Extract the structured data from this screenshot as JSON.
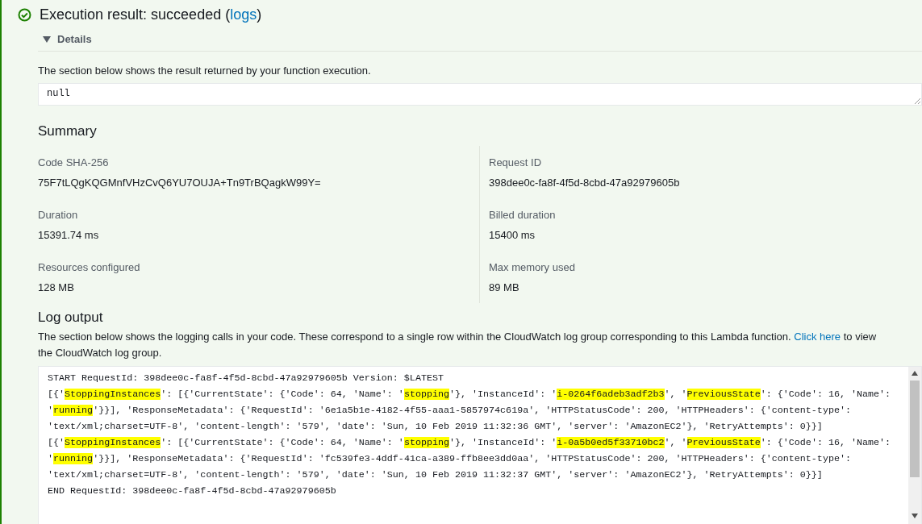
{
  "result": {
    "title_before": "Execution result:",
    "status": "succeeded",
    "title_mid": "(",
    "link": "logs",
    "title_after": ")"
  },
  "details": {
    "label": "Details",
    "expanded": true
  },
  "result_note": "The section below shows the result returned by your function execution.",
  "result_value": "null",
  "summary": {
    "title": "Summary",
    "fields": [
      {
        "label": "Code SHA-256",
        "value": "75F7tLQgKQGMnfVHzCvQ6YU7OUJA+Tn9TrBQagkW99Y="
      },
      {
        "label": "Request ID",
        "value": "398dee0c-fa8f-4f5d-8cbd-47a92979605b"
      },
      {
        "label": "Duration",
        "value": "15391.74 ms"
      },
      {
        "label": "Billed duration",
        "value": "15400 ms"
      },
      {
        "label": "Resources configured",
        "value": "128 MB"
      },
      {
        "label": "Max memory used",
        "value": "89 MB"
      }
    ]
  },
  "log_output": {
    "title": "Log output",
    "note_before": "The section below shows the logging calls in your code. These correspond to a single row within the CloudWatch log group corresponding to this Lambda function.",
    "note_link": "Click here",
    "note_after": "to view the CloudWatch log group.",
    "entries": [
      [
        {
          "text": "START RequestId: 398dee0c-fa8f-4f5d-8cbd-47a92979605b Version: $LATEST",
          "highlighted": false
        }
      ],
      [
        {
          "text": "[{'",
          "highlighted": false
        },
        {
          "text": "StoppingInstances",
          "highlighted": true
        },
        {
          "text": "': [{'CurrentState': {'Code': 64, 'Name': '",
          "highlighted": false
        },
        {
          "text": "stopping",
          "highlighted": true
        },
        {
          "text": "'}, 'InstanceId': '",
          "highlighted": false
        },
        {
          "text": "i-0264f6adeb3adf2b3",
          "highlighted": true
        },
        {
          "text": "', '",
          "highlighted": false
        },
        {
          "text": "PreviousState",
          "highlighted": true
        },
        {
          "text": "': {'Code': 16, 'Name': '",
          "highlighted": false
        },
        {
          "text": "running",
          "highlighted": true
        },
        {
          "text": "'}}], 'ResponseMetadata': {'RequestId': '6e1a5b1e-4182-4f55-aaa1-5857974c619a', 'HTTPStatusCode': 200, 'HTTPHeaders': {'content-type': 'text/xml;charset=UTF-8', 'content-length': '579', 'date': 'Sun, 10 Feb 2019 11:32:36 GMT', 'server': 'AmazonEC2'}, 'RetryAttempts': 0}}]",
          "highlighted": false
        }
      ],
      [
        {
          "text": "[{'",
          "highlighted": false
        },
        {
          "text": "StoppingInstances",
          "highlighted": true
        },
        {
          "text": "': [{'CurrentState': {'Code': 64, 'Name': '",
          "highlighted": false
        },
        {
          "text": "stopping",
          "highlighted": true
        },
        {
          "text": "'}, 'InstanceId': '",
          "highlighted": false
        },
        {
          "text": "i-0a5b0ed5f33710bc2",
          "highlighted": true
        },
        {
          "text": "', '",
          "highlighted": false
        },
        {
          "text": "PreviousState",
          "highlighted": true
        },
        {
          "text": "': {'Code': 16, 'Name': '",
          "highlighted": false
        },
        {
          "text": "running",
          "highlighted": true
        },
        {
          "text": "'}}], 'ResponseMetadata': {'RequestId': 'fc539fe3-4ddf-41ca-a389-ffb8ee3dd0aa', 'HTTPStatusCode': 200, 'HTTPHeaders': {'content-type': 'text/xml;charset=UTF-8', 'content-length': '579', 'date': 'Sun, 10 Feb 2019 11:32:37 GMT', 'server': 'AmazonEC2'}, 'RetryAttempts': 0}}]",
          "highlighted": false
        }
      ],
      [
        {
          "text": "END RequestId: 398dee0c-fa8f-4f5d-8cbd-47a92979605b",
          "highlighted": false
        }
      ]
    ]
  }
}
